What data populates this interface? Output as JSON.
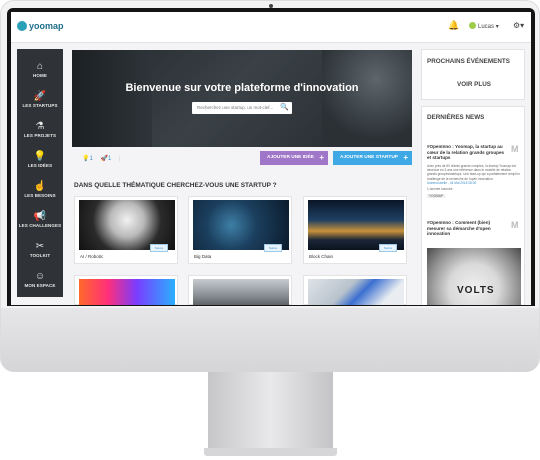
{
  "brand": {
    "logo_text": "yoomap",
    "accent": "#2aa0b8"
  },
  "topbar": {
    "bell_icon": "bell-icon",
    "user_name": "Lucas",
    "user_caret": "▾",
    "settings_icon": "gear-icon"
  },
  "sidebar": {
    "items": [
      {
        "label": "HOME",
        "icon": "⌂"
      },
      {
        "label": "LES STARTUPS",
        "icon": "🚀"
      },
      {
        "label": "LES PROJETS",
        "icon": "⚗"
      },
      {
        "label": "LES IDÉES",
        "icon": "💡"
      },
      {
        "label": "LES BESOINS",
        "icon": "☝"
      },
      {
        "label": "LES CHALLENGES",
        "icon": "📢"
      },
      {
        "label": "TOOLKIT",
        "icon": "✂"
      },
      {
        "label": "MON ESPACE",
        "icon": "☺"
      }
    ]
  },
  "hero": {
    "title": "Bienvenue sur votre plateforme d'innovation",
    "search_placeholder": "Recherchez une startup, un mot-clef...",
    "search_icon": "🔍"
  },
  "counters": {
    "ideas": "1",
    "startups": "1"
  },
  "actions": {
    "add_idea": "AJOUTER UNE IDÉE",
    "add_startup": "AJOUTER UNE STARTUP",
    "plus": "+"
  },
  "themes": {
    "question": "DANS QUELLE THÉMATIQUE CHERCHEZ-VOUS UNE STARTUP ?",
    "cards": [
      {
        "label": "AI / Robotic",
        "badge": "Suivre"
      },
      {
        "label": "Big Data",
        "badge": "Suivre"
      },
      {
        "label": "Block Chain",
        "badge": "Suivre"
      }
    ]
  },
  "events": {
    "title": "PROCHAINS ÉVÉNEMENTS",
    "link": "VOIR PLUS"
  },
  "news": {
    "title": "DERNIÈRES NEWS",
    "items": [
      {
        "title": "#OpenInno : Yoomap, la startup au cœur de la relation grands groupes et startups",
        "logo": "M",
        "body": "Avec près de 60 clients grands comptes, la startup Yoomap est devenue en 3 ans une référence dans le modèle de relation grands groupes/startups. Une start-up qui a parfaitement rempli le challenge de la recherche de l'open innovation.",
        "date": "Usinenouvelle - 04 Mai 2018 08:00",
        "reads": "1 donnée sourcée",
        "tag": "YOOMAP"
      },
      {
        "title": "#OpenInno : Comment (bien) mesurer sa démarche d'open innovation",
        "logo": "M",
        "image_text": "VOLTS"
      }
    ]
  }
}
